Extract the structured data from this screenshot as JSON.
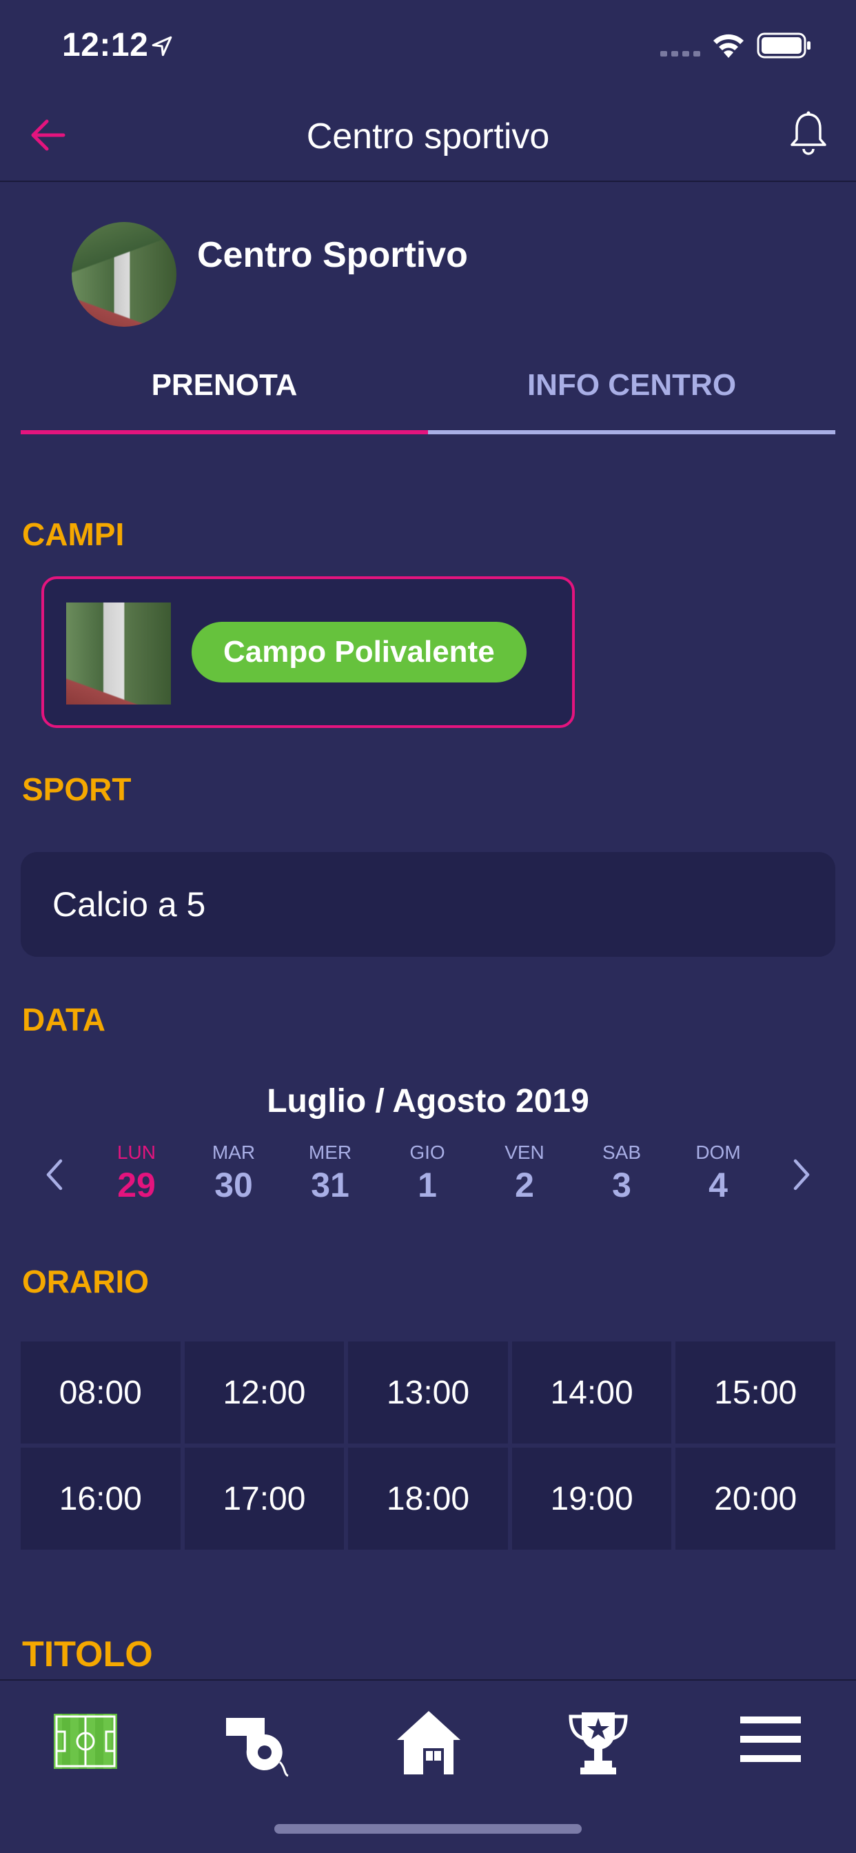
{
  "status_bar": {
    "time": "12:12"
  },
  "nav": {
    "title": "Centro sportivo"
  },
  "center": {
    "name": "Centro Sportivo"
  },
  "tabs": [
    {
      "label": "PRENOTA",
      "active": true
    },
    {
      "label": "INFO CENTRO",
      "active": false
    }
  ],
  "sections": {
    "campi": "CAMPI",
    "sport": "SPORT",
    "data": "DATA",
    "orario": "ORARIO",
    "titolo": "TITOLO"
  },
  "field": {
    "name": "Campo Polivalente"
  },
  "sport": {
    "selected": "Calcio a 5"
  },
  "calendar": {
    "month": "Luglio / Agosto 2019",
    "days": [
      {
        "name": "LUN",
        "num": "29",
        "active": true
      },
      {
        "name": "MAR",
        "num": "30"
      },
      {
        "name": "MER",
        "num": "31"
      },
      {
        "name": "GIO",
        "num": "1"
      },
      {
        "name": "VEN",
        "num": "2"
      },
      {
        "name": "SAB",
        "num": "3"
      },
      {
        "name": "DOM",
        "num": "4"
      }
    ]
  },
  "times": [
    "08:00",
    "12:00",
    "13:00",
    "14:00",
    "15:00",
    "16:00",
    "17:00",
    "18:00",
    "19:00",
    "20:00"
  ],
  "colors": {
    "background": "#2b2b5a",
    "accent": "#e4147e",
    "section": "#f5a800",
    "pill": "#66c23d",
    "muted": "#a9afe6"
  },
  "bottom_nav": [
    "field-icon",
    "whistle-icon",
    "home-icon",
    "trophy-icon",
    "menu-icon"
  ]
}
